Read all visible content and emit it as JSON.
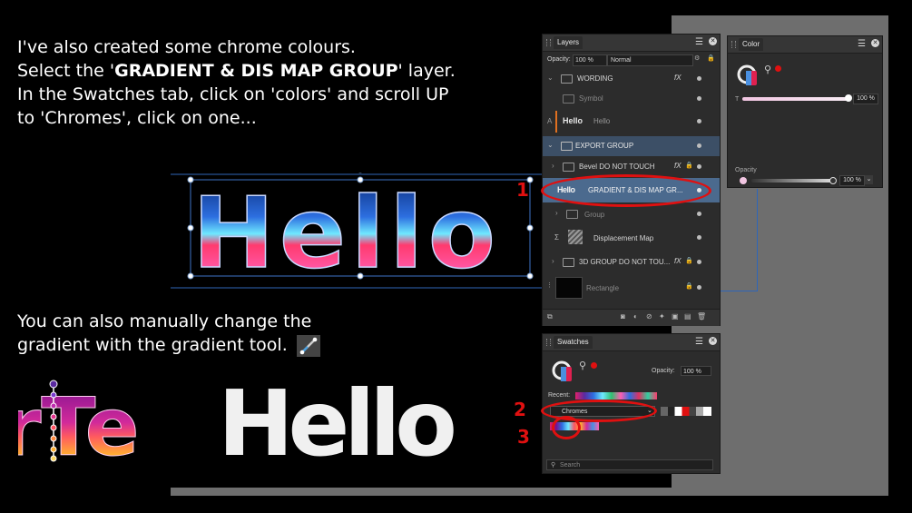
{
  "instructions": {
    "line1": "I've also created some chrome colours.",
    "line2_pre": "Select the '",
    "line2_bold": "GRADIENT & DIS MAP GROUP",
    "line2_post": "' layer.",
    "line3": "In the Swatches tab, click on 'colors' and scroll UP",
    "line4": "to 'Chromes', click on one...",
    "gradient_line1": "You can also manually change the",
    "gradient_line2": "gradient with the gradient tool."
  },
  "canvas": {
    "hello_text": "Hello",
    "hello_plain": "Hello",
    "partial_text": "rTe"
  },
  "annotations": {
    "n1": "1",
    "n2": "2",
    "n3": "3"
  },
  "layers_panel": {
    "tab": "Layers",
    "opacity_label": "Opacity:",
    "opacity_value": "100 %",
    "blend_mode": "Normal",
    "fx": "fX",
    "rows": {
      "wording": "WORDING",
      "symbol": "Symbol",
      "hello_thumb": "Hello",
      "hello": "Hello",
      "export_group": "EXPORT GROUP",
      "bevel": "Bevel DO NOT TOUCH",
      "gradient_thumb": "Hello",
      "gradient": "GRADIENT & DIS MAP GR...",
      "group": "Group",
      "displacement": "Displacement Map",
      "three_d": "3D GROUP DO NOT TOU...",
      "rectangle": "Rectangle"
    }
  },
  "color_panel": {
    "tab": "Color",
    "t_label": "T",
    "t_value": "100 %",
    "opacity_label": "Opacity",
    "opacity_value": "100 %"
  },
  "swatches_panel": {
    "tab": "Swatches",
    "opacity_label": "Opacity:",
    "opacity_value": "100 %",
    "recent_label": "Recent:",
    "category": "Chromes",
    "search_placeholder": "Search"
  },
  "colors": {
    "accent_red": "#e01010",
    "selection_blue": "#4b6a8e",
    "panel_bg": "#2c2c2c",
    "backdrop_grey": "#6e6e6e"
  }
}
